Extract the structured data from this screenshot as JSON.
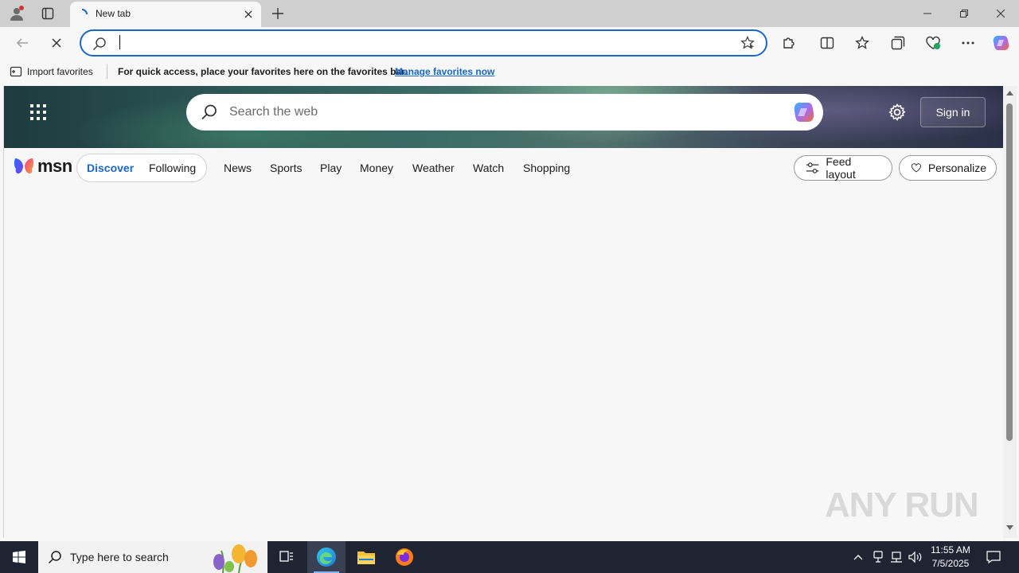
{
  "browser": {
    "tab_title": "New tab",
    "address_value": "",
    "favorites_bar": {
      "import_label": "Import favorites",
      "message": "For quick access, place your favorites here on the favorites bar.",
      "manage_link": "Manage favorites now"
    }
  },
  "msn": {
    "search_placeholder": "Search the web",
    "sign_in": "Sign in",
    "logo_text": "msn",
    "pill_tabs": [
      "Discover",
      "Following"
    ],
    "nav_links": [
      "News",
      "Sports",
      "Play",
      "Money",
      "Weather",
      "Watch",
      "Shopping"
    ],
    "feed_layout": "Feed layout",
    "personalize": "Personalize"
  },
  "watermark": "ANY RUN",
  "taskbar": {
    "search_placeholder": "Type here to search",
    "time": "11:55 AM",
    "date": "7/5/2025"
  },
  "colors": {
    "accent": "#1868c9",
    "taskbar": "#1f2433",
    "titlebar": "#cfcfcf"
  }
}
